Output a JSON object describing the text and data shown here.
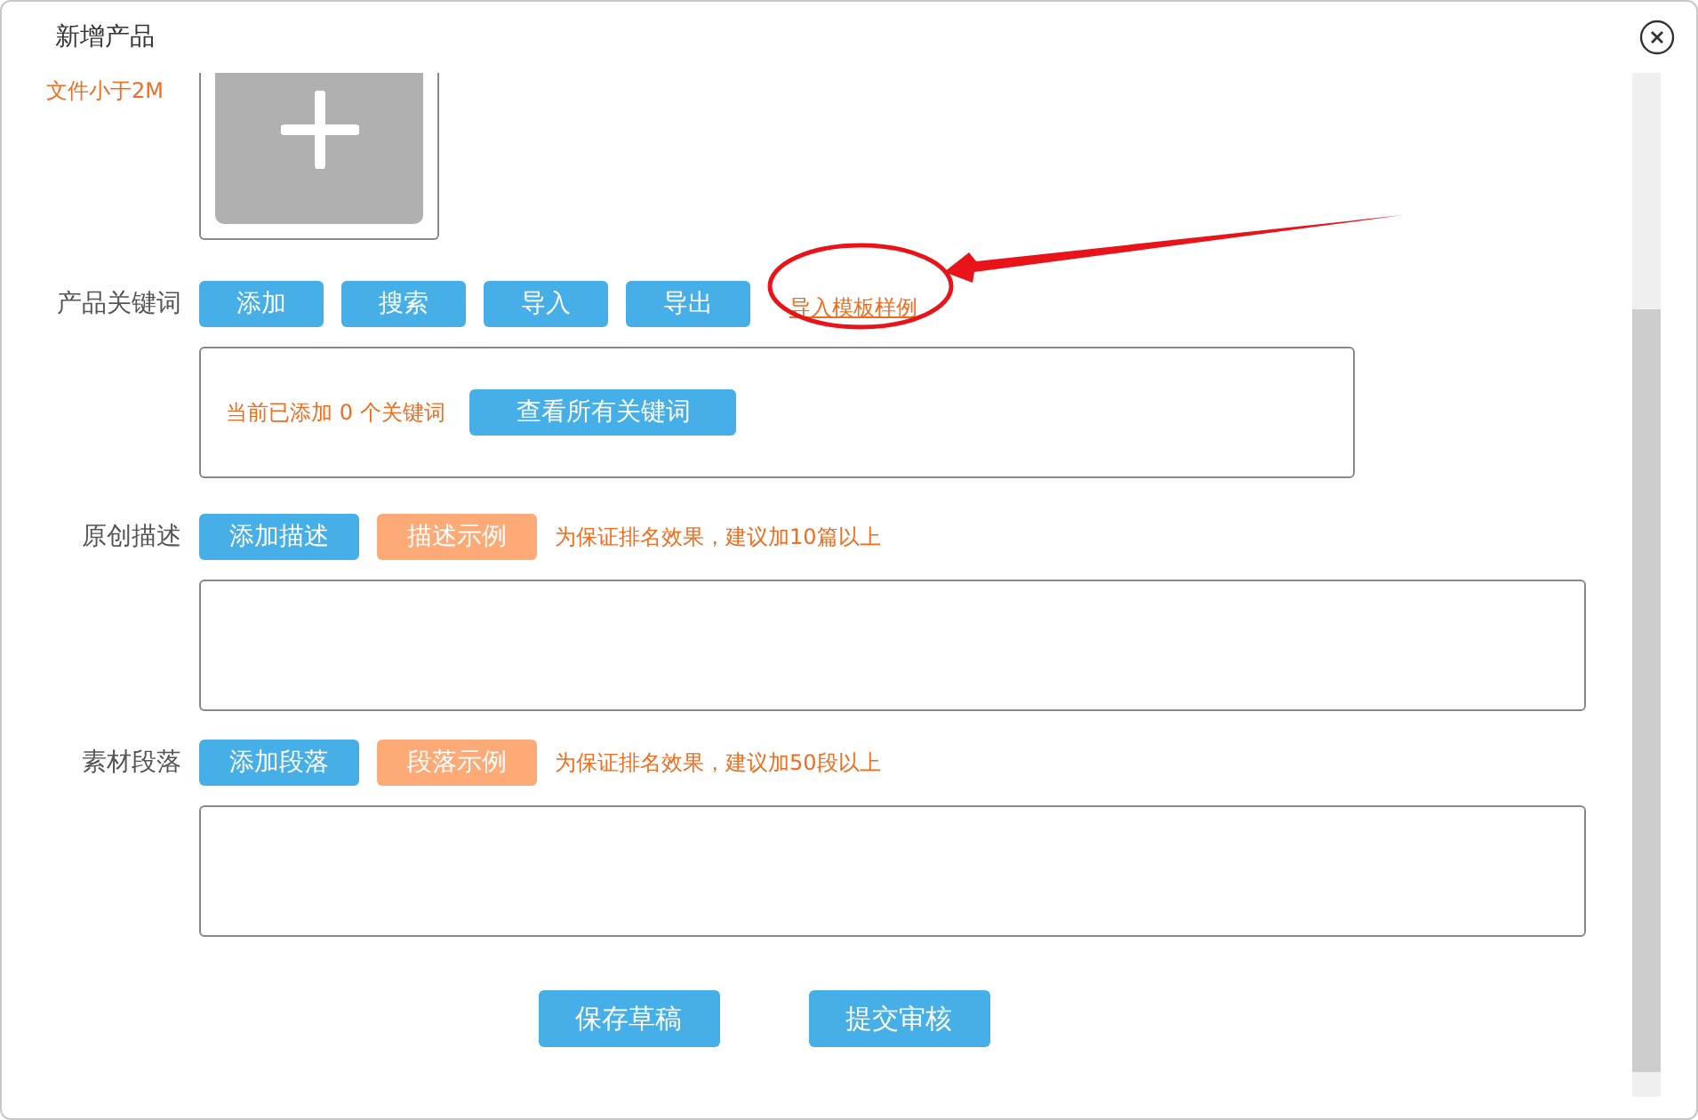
{
  "dialog": {
    "title": "新增产品"
  },
  "upload": {
    "hint": "文件小于2M"
  },
  "keywords": {
    "label": "产品关键词",
    "buttons": [
      "添加",
      "搜索",
      "导入",
      "导出"
    ],
    "link": "导入模板样例",
    "count_text": "当前已添加 0 个关键词",
    "view_button": "查看所有关键词"
  },
  "sections": [
    {
      "label": "原创描述",
      "buttons": [
        {
          "label": "添加描述",
          "kind": "primary"
        },
        {
          "label": "描述示例",
          "kind": "sample"
        }
      ],
      "hint": "为保证排名效果，建议加10篇以上"
    },
    {
      "label": "素材段落",
      "buttons": [
        {
          "label": "添加段落",
          "kind": "primary"
        },
        {
          "label": "段落示例",
          "kind": "sample"
        }
      ],
      "hint": "为保证排名效果，建议加50段以上"
    }
  ],
  "footer": {
    "buttons": [
      "保存草稿",
      "提交审核"
    ]
  }
}
